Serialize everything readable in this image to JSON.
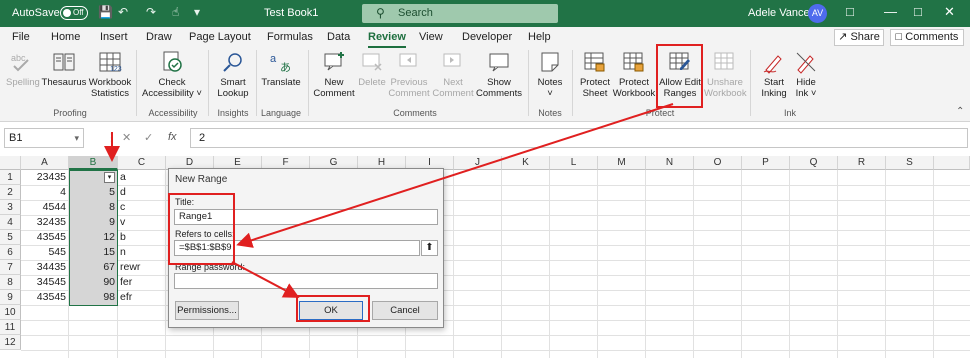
{
  "titlebar": {
    "autosave_label": "AutoSave",
    "autosave_state": "Off",
    "doc_title": "Test Book1",
    "search_placeholder": "Search",
    "user_name": "Adele Vance",
    "user_initials": "AV",
    "qat_icons": [
      "save-icon",
      "undo-icon",
      "redo-icon",
      "touch-mode-icon",
      "customize-icon"
    ],
    "window_icons": [
      "ribbon-display-icon",
      "minimize-icon",
      "maximize-icon",
      "close-icon"
    ]
  },
  "menu": {
    "tabs": [
      "File",
      "Home",
      "Insert",
      "Draw",
      "Page Layout",
      "Formulas",
      "Data",
      "Review",
      "View",
      "Developer",
      "Help"
    ],
    "active_tab": "Review",
    "share_label": "Share",
    "comments_label": "Comments"
  },
  "ribbon": {
    "buttons": {
      "spelling": "Spelling",
      "thesaurus": "Thesaurus",
      "workbook_statistics": [
        "Workbook",
        "Statistics"
      ],
      "check_accessibility": [
        "Check",
        "Accessibility ˅"
      ],
      "smart_lookup": [
        "Smart",
        "Lookup"
      ],
      "translate": "Translate",
      "new_comment": [
        "New",
        "Comment"
      ],
      "delete": "Delete",
      "previous_comment": [
        "Previous",
        "Comment"
      ],
      "next_comment": [
        "Next",
        "Comment"
      ],
      "show_comments": [
        "Show",
        "Comments"
      ],
      "notes": [
        "Notes",
        "˅"
      ],
      "protect_sheet": [
        "Protect",
        "Sheet"
      ],
      "protect_workbook": [
        "Protect",
        "Workbook"
      ],
      "allow_edit_ranges": [
        "Allow Edit",
        "Ranges"
      ],
      "unshare_workbook": [
        "Unshare",
        "Workbook"
      ],
      "start_inking": [
        "Start",
        "Inking"
      ],
      "hide_ink": [
        "Hide",
        "Ink ˅"
      ]
    },
    "groups": {
      "proofing": "Proofing",
      "accessibility": "Accessibility",
      "insights": "Insights",
      "language": "Language",
      "comments": "Comments",
      "notes": "Notes",
      "protect": "Protect",
      "ink": "Ink"
    }
  },
  "formula_bar": {
    "name_box": "B1",
    "fx": "fx",
    "value": "2"
  },
  "grid": {
    "columns": [
      "A",
      "B",
      "C",
      "D",
      "E",
      "F",
      "G",
      "H",
      "I",
      "J",
      "K",
      "L",
      "M",
      "N",
      "O",
      "P",
      "Q",
      "R",
      "S"
    ],
    "rows": [
      "1",
      "2",
      "3",
      "4",
      "5",
      "6",
      "7",
      "8",
      "9",
      "10",
      "11",
      "12"
    ],
    "col_a": [
      "23435",
      "4",
      "4544",
      "32435",
      "43545",
      "545",
      "34435",
      "34545",
      "43545"
    ],
    "col_b": [
      "",
      "5",
      "8",
      "9",
      "12",
      "15",
      "67",
      "90",
      "98"
    ],
    "col_c": [
      "a",
      "d",
      "c",
      "v",
      "b",
      "n",
      "rewr",
      "fer",
      "efr"
    ],
    "selected_column": "B"
  },
  "dialog": {
    "title": "New Range",
    "title_label": "Title:",
    "title_value": "Range1",
    "refers_label": "Refers to cells:",
    "refers_value": "=$B$1:$B$9",
    "password_label": "Range password:",
    "password_value": "",
    "permissions_button": "Permissions...",
    "ok_button": "OK",
    "cancel_button": "Cancel"
  },
  "annotations": {
    "color": "#e02020"
  }
}
